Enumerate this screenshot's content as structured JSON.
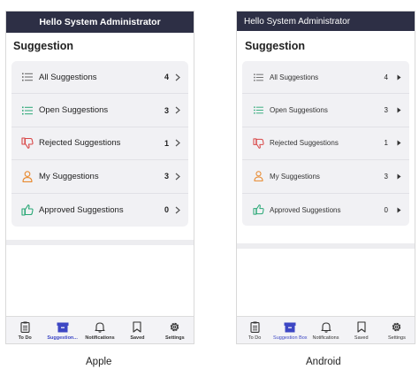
{
  "header": {
    "greeting": "Hello System Administrator"
  },
  "page": {
    "title": "Suggestion"
  },
  "menu": {
    "items": [
      {
        "label": "All Suggestions",
        "count": "4",
        "icon": "list-icon"
      },
      {
        "label": "Open Suggestions",
        "count": "3",
        "icon": "list-icon"
      },
      {
        "label": "Rejected Suggestions",
        "count": "1",
        "icon": "thumbs-down-icon"
      },
      {
        "label": "My Suggestions",
        "count": "3",
        "icon": "user-icon"
      },
      {
        "label": "Approved Suggestions",
        "count": "0",
        "icon": "thumbs-up-icon"
      }
    ]
  },
  "tabs": {
    "apple": [
      "To Do",
      "Suggestion...",
      "Notifications",
      "Saved",
      "Settings"
    ],
    "android": [
      "To Do",
      "Suggestion Box",
      "Notifications",
      "Saved",
      "Settings"
    ]
  },
  "captions": {
    "apple": "Apple",
    "android": "Android"
  },
  "colors": {
    "header": "#2d2f45",
    "accent": "#3d47c4",
    "open_icon": "#2aa876",
    "rejected_icon": "#d94848",
    "my_icon": "#e8892e",
    "approved_icon": "#2aa876"
  }
}
